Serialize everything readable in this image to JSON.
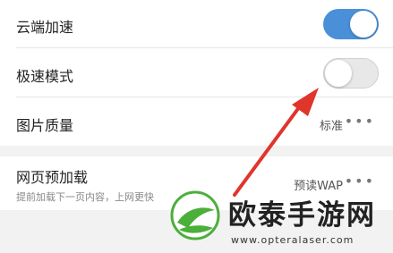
{
  "settings": {
    "cloud_accel": {
      "label": "云端加速",
      "enabled": true
    },
    "speed_mode": {
      "label": "极速模式",
      "enabled": false
    },
    "image_quality": {
      "label": "图片质量",
      "value": "标准",
      "more": "•••"
    },
    "preload": {
      "label": "网页预加载",
      "value": "预读WAP",
      "more": "•••",
      "description": "提前加载下一页内容，上网更快"
    }
  },
  "watermark": {
    "title": "欧泰手游网",
    "url": "www.opteralaser.com"
  },
  "colors": {
    "toggle_on": "#4a90d9",
    "arrow": "#e0352b",
    "logo_green": "#4caf3a"
  }
}
